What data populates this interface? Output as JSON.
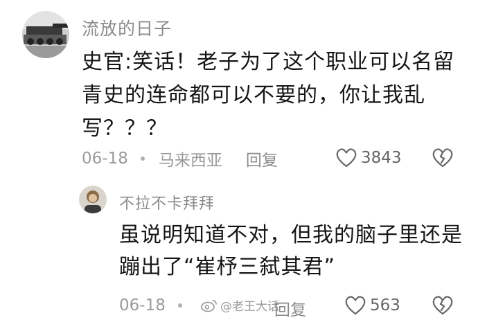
{
  "comments": [
    {
      "username": "流放的日子",
      "text": "史官:笑话！老子为了这个职业可以名留青史的连命都可以不要的，你让我乱写？？？",
      "date": "06-18",
      "location": "马来西亚",
      "reply_label": "回复",
      "like_count": "3843",
      "icons": {
        "like": "heart-outline-icon",
        "dislike": "broken-heart-icon"
      }
    },
    {
      "username": "不拉不卡拜拜",
      "text": "虽说明知道不对，但我的脑子里还是蹦出了“崔杼三弑其君”",
      "date": "06-18",
      "location": "",
      "reply_label": "回复",
      "like_count": "563",
      "icons": {
        "like": "heart-outline-icon",
        "dislike": "broken-heart-icon"
      }
    }
  ],
  "watermark": {
    "text": "@老王大话",
    "icon": "weibo-logo-icon"
  },
  "colors": {
    "username": "#8b8b8b",
    "body_text": "#151515",
    "meta": "#9a9a9a",
    "icon": "#666666"
  }
}
